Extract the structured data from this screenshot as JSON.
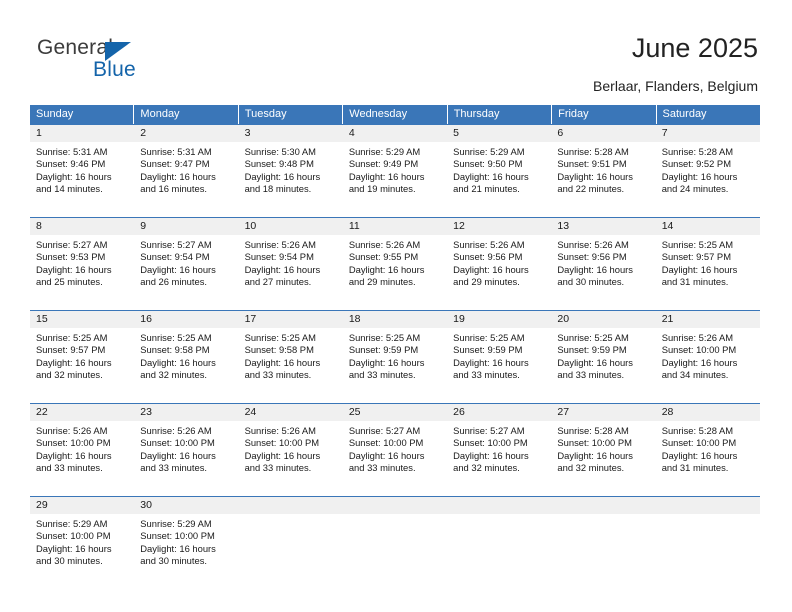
{
  "brand": {
    "name_part1": "General",
    "name_part2": "Blue",
    "triangle_icon": "triangle-icon",
    "accent_color": "#1464aa"
  },
  "header": {
    "title": "June 2025",
    "location": "Berlaar, Flanders, Belgium"
  },
  "theme": {
    "header_bg": "#3a76b8",
    "daynum_bg": "#f0f0f0",
    "rule_color": "#3a76b8",
    "text_color": "#1a1a1a"
  },
  "weekdays": [
    "Sunday",
    "Monday",
    "Tuesday",
    "Wednesday",
    "Thursday",
    "Friday",
    "Saturday"
  ],
  "weeks": [
    {
      "days": [
        {
          "num": "1",
          "sunrise": "Sunrise: 5:31 AM",
          "sunset": "Sunset: 9:46 PM",
          "daylight": "Daylight: 16 hours and 14 minutes."
        },
        {
          "num": "2",
          "sunrise": "Sunrise: 5:31 AM",
          "sunset": "Sunset: 9:47 PM",
          "daylight": "Daylight: 16 hours and 16 minutes."
        },
        {
          "num": "3",
          "sunrise": "Sunrise: 5:30 AM",
          "sunset": "Sunset: 9:48 PM",
          "daylight": "Daylight: 16 hours and 18 minutes."
        },
        {
          "num": "4",
          "sunrise": "Sunrise: 5:29 AM",
          "sunset": "Sunset: 9:49 PM",
          "daylight": "Daylight: 16 hours and 19 minutes."
        },
        {
          "num": "5",
          "sunrise": "Sunrise: 5:29 AM",
          "sunset": "Sunset: 9:50 PM",
          "daylight": "Daylight: 16 hours and 21 minutes."
        },
        {
          "num": "6",
          "sunrise": "Sunrise: 5:28 AM",
          "sunset": "Sunset: 9:51 PM",
          "daylight": "Daylight: 16 hours and 22 minutes."
        },
        {
          "num": "7",
          "sunrise": "Sunrise: 5:28 AM",
          "sunset": "Sunset: 9:52 PM",
          "daylight": "Daylight: 16 hours and 24 minutes."
        }
      ]
    },
    {
      "days": [
        {
          "num": "8",
          "sunrise": "Sunrise: 5:27 AM",
          "sunset": "Sunset: 9:53 PM",
          "daylight": "Daylight: 16 hours and 25 minutes."
        },
        {
          "num": "9",
          "sunrise": "Sunrise: 5:27 AM",
          "sunset": "Sunset: 9:54 PM",
          "daylight": "Daylight: 16 hours and 26 minutes."
        },
        {
          "num": "10",
          "sunrise": "Sunrise: 5:26 AM",
          "sunset": "Sunset: 9:54 PM",
          "daylight": "Daylight: 16 hours and 27 minutes."
        },
        {
          "num": "11",
          "sunrise": "Sunrise: 5:26 AM",
          "sunset": "Sunset: 9:55 PM",
          "daylight": "Daylight: 16 hours and 29 minutes."
        },
        {
          "num": "12",
          "sunrise": "Sunrise: 5:26 AM",
          "sunset": "Sunset: 9:56 PM",
          "daylight": "Daylight: 16 hours and 29 minutes."
        },
        {
          "num": "13",
          "sunrise": "Sunrise: 5:26 AM",
          "sunset": "Sunset: 9:56 PM",
          "daylight": "Daylight: 16 hours and 30 minutes."
        },
        {
          "num": "14",
          "sunrise": "Sunrise: 5:25 AM",
          "sunset": "Sunset: 9:57 PM",
          "daylight": "Daylight: 16 hours and 31 minutes."
        }
      ]
    },
    {
      "days": [
        {
          "num": "15",
          "sunrise": "Sunrise: 5:25 AM",
          "sunset": "Sunset: 9:57 PM",
          "daylight": "Daylight: 16 hours and 32 minutes."
        },
        {
          "num": "16",
          "sunrise": "Sunrise: 5:25 AM",
          "sunset": "Sunset: 9:58 PM",
          "daylight": "Daylight: 16 hours and 32 minutes."
        },
        {
          "num": "17",
          "sunrise": "Sunrise: 5:25 AM",
          "sunset": "Sunset: 9:58 PM",
          "daylight": "Daylight: 16 hours and 33 minutes."
        },
        {
          "num": "18",
          "sunrise": "Sunrise: 5:25 AM",
          "sunset": "Sunset: 9:59 PM",
          "daylight": "Daylight: 16 hours and 33 minutes."
        },
        {
          "num": "19",
          "sunrise": "Sunrise: 5:25 AM",
          "sunset": "Sunset: 9:59 PM",
          "daylight": "Daylight: 16 hours and 33 minutes."
        },
        {
          "num": "20",
          "sunrise": "Sunrise: 5:25 AM",
          "sunset": "Sunset: 9:59 PM",
          "daylight": "Daylight: 16 hours and 33 minutes."
        },
        {
          "num": "21",
          "sunrise": "Sunrise: 5:26 AM",
          "sunset": "Sunset: 10:00 PM",
          "daylight": "Daylight: 16 hours and 34 minutes."
        }
      ]
    },
    {
      "days": [
        {
          "num": "22",
          "sunrise": "Sunrise: 5:26 AM",
          "sunset": "Sunset: 10:00 PM",
          "daylight": "Daylight: 16 hours and 33 minutes."
        },
        {
          "num": "23",
          "sunrise": "Sunrise: 5:26 AM",
          "sunset": "Sunset: 10:00 PM",
          "daylight": "Daylight: 16 hours and 33 minutes."
        },
        {
          "num": "24",
          "sunrise": "Sunrise: 5:26 AM",
          "sunset": "Sunset: 10:00 PM",
          "daylight": "Daylight: 16 hours and 33 minutes."
        },
        {
          "num": "25",
          "sunrise": "Sunrise: 5:27 AM",
          "sunset": "Sunset: 10:00 PM",
          "daylight": "Daylight: 16 hours and 33 minutes."
        },
        {
          "num": "26",
          "sunrise": "Sunrise: 5:27 AM",
          "sunset": "Sunset: 10:00 PM",
          "daylight": "Daylight: 16 hours and 32 minutes."
        },
        {
          "num": "27",
          "sunrise": "Sunrise: 5:28 AM",
          "sunset": "Sunset: 10:00 PM",
          "daylight": "Daylight: 16 hours and 32 minutes."
        },
        {
          "num": "28",
          "sunrise": "Sunrise: 5:28 AM",
          "sunset": "Sunset: 10:00 PM",
          "daylight": "Daylight: 16 hours and 31 minutes."
        }
      ]
    },
    {
      "days": [
        {
          "num": "29",
          "sunrise": "Sunrise: 5:29 AM",
          "sunset": "Sunset: 10:00 PM",
          "daylight": "Daylight: 16 hours and 30 minutes."
        },
        {
          "num": "30",
          "sunrise": "Sunrise: 5:29 AM",
          "sunset": "Sunset: 10:00 PM",
          "daylight": "Daylight: 16 hours and 30 minutes."
        },
        {
          "num": "",
          "sunrise": "",
          "sunset": "",
          "daylight": ""
        },
        {
          "num": "",
          "sunrise": "",
          "sunset": "",
          "daylight": ""
        },
        {
          "num": "",
          "sunrise": "",
          "sunset": "",
          "daylight": ""
        },
        {
          "num": "",
          "sunrise": "",
          "sunset": "",
          "daylight": ""
        },
        {
          "num": "",
          "sunrise": "",
          "sunset": "",
          "daylight": ""
        }
      ]
    }
  ]
}
